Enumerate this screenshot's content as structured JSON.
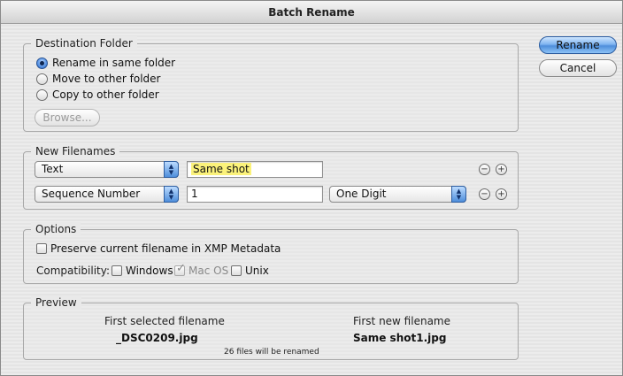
{
  "window": {
    "title": "Batch Rename"
  },
  "buttons": {
    "rename": "Rename",
    "cancel": "Cancel"
  },
  "destination": {
    "title": "Destination Folder",
    "options": [
      {
        "label": "Rename in same folder",
        "selected": true
      },
      {
        "label": "Move to other folder",
        "selected": false
      },
      {
        "label": "Copy to other folder",
        "selected": false
      }
    ],
    "browse_label": "Browse..."
  },
  "new_filenames": {
    "title": "New Filenames",
    "rows": [
      {
        "type": "Text",
        "value": "Same shot",
        "remove_icon": "minus-circle-icon",
        "add_icon": "plus-circle-icon"
      },
      {
        "type": "Sequence Number",
        "value": "1",
        "option": "One Digit",
        "remove_icon": "minus-circle-icon",
        "add_icon": "plus-circle-icon"
      }
    ]
  },
  "options": {
    "title": "Options",
    "preserve_label": "Preserve current filename in XMP Metadata",
    "preserve_checked": false,
    "compatibility_label": "Compatibility:",
    "platforms": [
      {
        "label": "Windows",
        "checked": false,
        "enabled": true
      },
      {
        "label": "Mac OS",
        "checked": true,
        "enabled": false
      },
      {
        "label": "Unix",
        "checked": false,
        "enabled": true
      }
    ]
  },
  "preview": {
    "title": "Preview",
    "first_selected_label": "First selected filename",
    "first_selected_value": "_DSC0209.jpg",
    "first_new_label": "First new filename",
    "first_new_value": "Same shot1.jpg",
    "count_text": "26 files will be renamed"
  },
  "colors": {
    "default_button": "#4f8fdb",
    "highlight": "#fbf27a"
  }
}
